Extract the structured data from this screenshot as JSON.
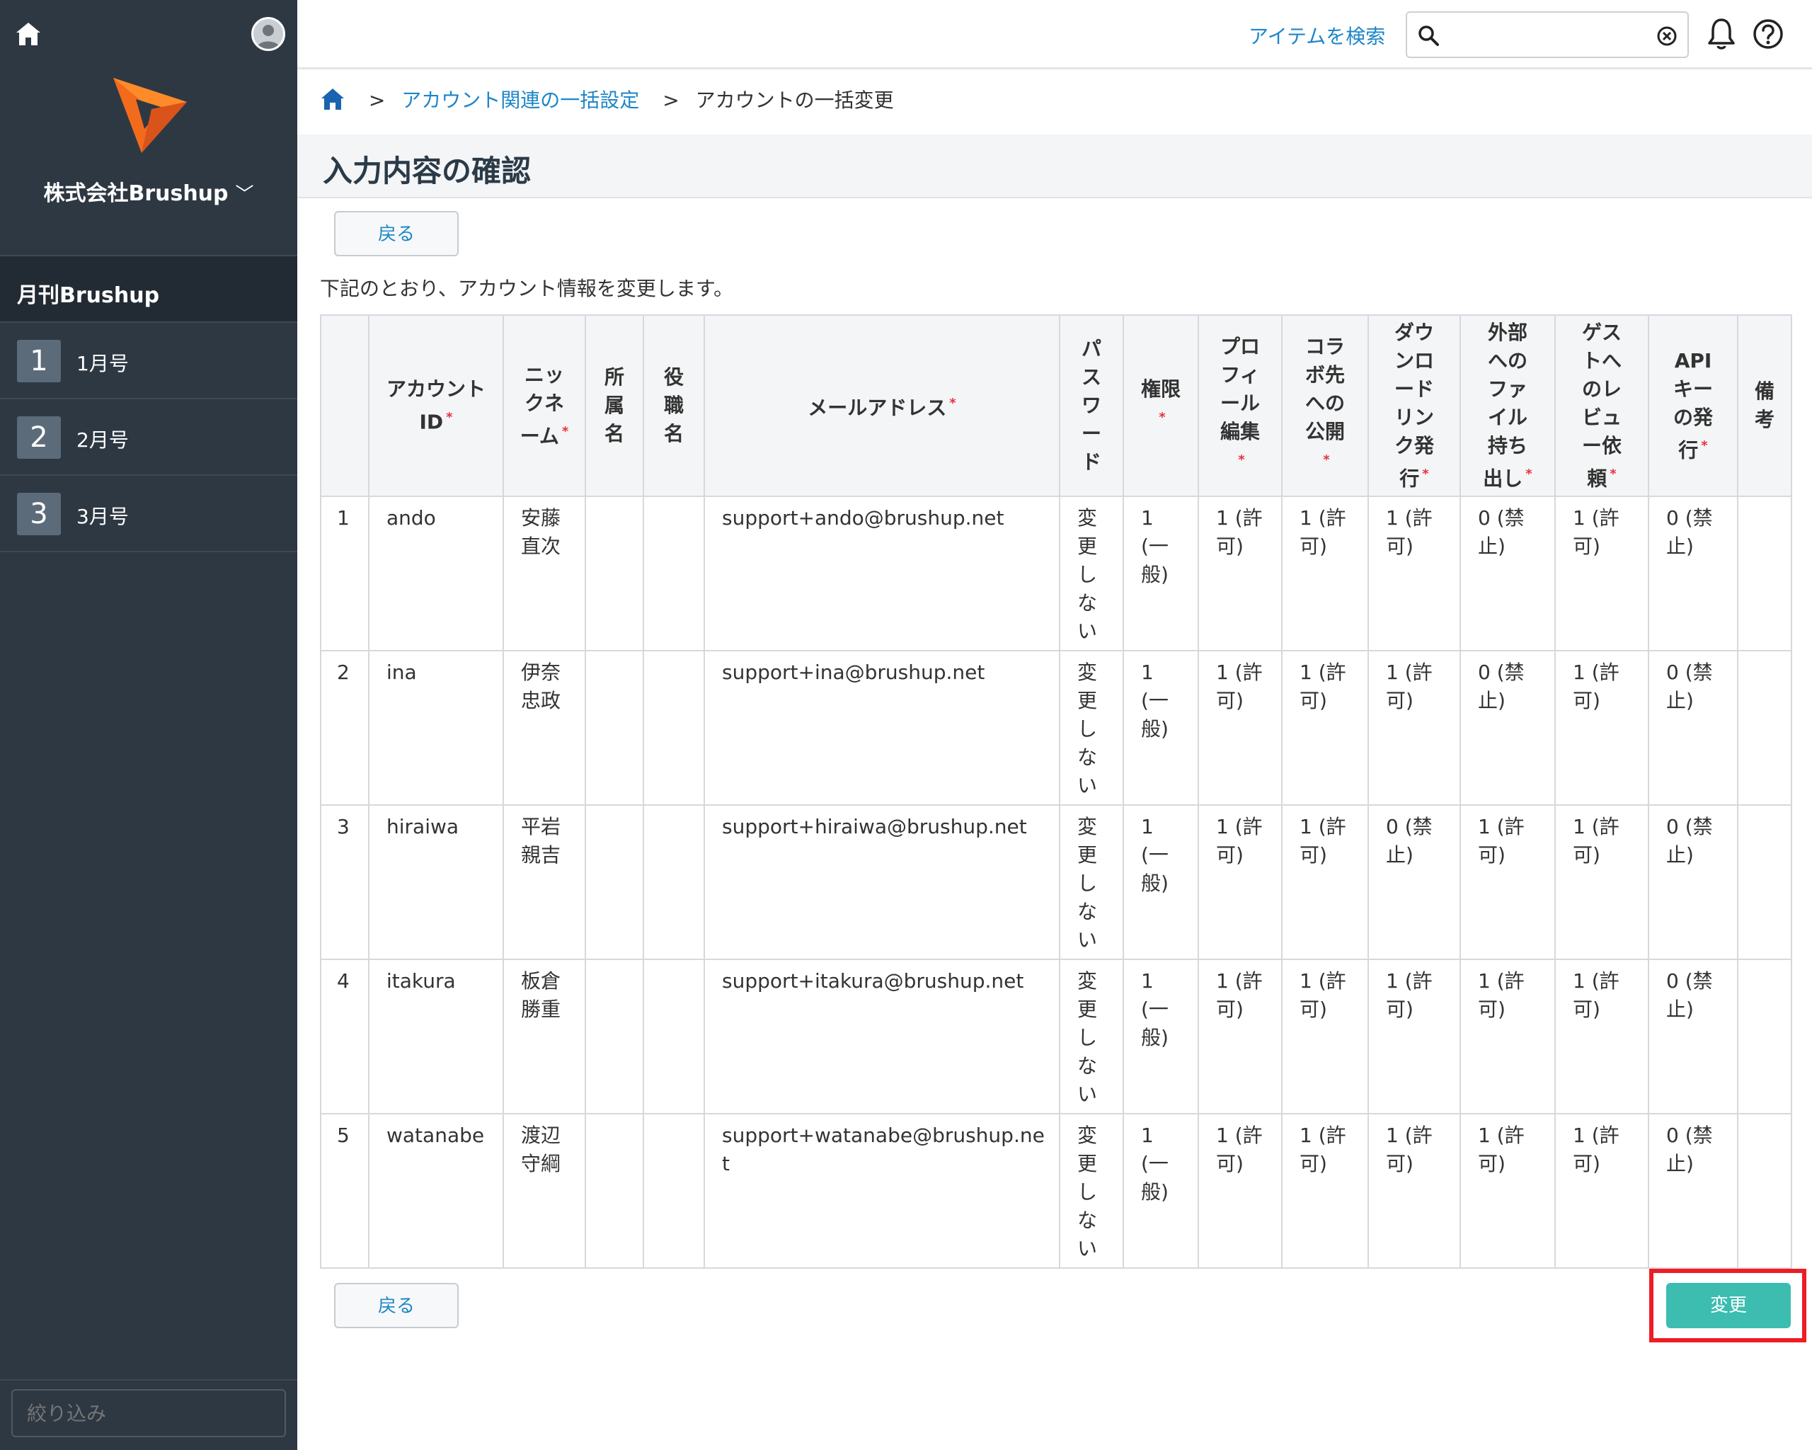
{
  "sidebar": {
    "company": "株式会社Brushup",
    "project": "月刊Brushup",
    "items": [
      {
        "num": "1",
        "label": "1月号"
      },
      {
        "num": "2",
        "label": "2月号"
      },
      {
        "num": "3",
        "label": "3月号"
      }
    ],
    "filter_placeholder": "絞り込み"
  },
  "topbar": {
    "search_link": "アイテムを検索",
    "search_value": ""
  },
  "breadcrumb": {
    "sep": ">",
    "items": [
      "アカウント関連の一括設定",
      "アカウントの一括変更"
    ]
  },
  "page": {
    "title": "入力内容の確認",
    "back_label": "戻る",
    "intro": "下記のとおり、アカウント情報を変更します。",
    "submit_label": "変更"
  },
  "table": {
    "headers": [
      {
        "label": ""
      },
      {
        "label": "アカウントID",
        "required": true
      },
      {
        "label": "ニックネーム",
        "required": true
      },
      {
        "label": "所属名"
      },
      {
        "label": "役職名"
      },
      {
        "label": "メールアドレス",
        "required": true
      },
      {
        "label": "パスワード"
      },
      {
        "label": "権限",
        "required": true
      },
      {
        "label": "プロフィール編集",
        "required": true
      },
      {
        "label": "コラボ先への公開",
        "required": true
      },
      {
        "label": "ダウンロードリンク発行",
        "required": true
      },
      {
        "label": "外部へのファイル持ち出し",
        "required": true
      },
      {
        "label": "ゲストへのレビュー依頼",
        "required": true
      },
      {
        "label": "APIキーの発行",
        "required": true
      },
      {
        "label": "備考"
      }
    ],
    "rows": [
      [
        "1",
        "ando",
        "安藤直次",
        "",
        "",
        "support+ando@brushup.net",
        "変更しない",
        "1 (一般)",
        "1 (許可)",
        "1 (許可)",
        "1 (許可)",
        "0 (禁止)",
        "1 (許可)",
        "0 (禁止)",
        ""
      ],
      [
        "2",
        "ina",
        "伊奈忠政",
        "",
        "",
        "support+ina@brushup.net",
        "変更しない",
        "1 (一般)",
        "1 (許可)",
        "1 (許可)",
        "1 (許可)",
        "0 (禁止)",
        "1 (許可)",
        "0 (禁止)",
        ""
      ],
      [
        "3",
        "hiraiwa",
        "平岩親吉",
        "",
        "",
        "support+hiraiwa@brushup.net",
        "変更しない",
        "1 (一般)",
        "1 (許可)",
        "1 (許可)",
        "0 (禁止)",
        "1 (許可)",
        "1 (許可)",
        "0 (禁止)",
        ""
      ],
      [
        "4",
        "itakura",
        "板倉勝重",
        "",
        "",
        "support+itakura@brushup.net",
        "変更しない",
        "1 (一般)",
        "1 (許可)",
        "1 (許可)",
        "1 (許可)",
        "1 (許可)",
        "1 (許可)",
        "0 (禁止)",
        ""
      ],
      [
        "5",
        "watanabe",
        "渡辺守綱",
        "",
        "",
        "support+watanabe@brushup.net",
        "変更しない",
        "1 (一般)",
        "1 (許可)",
        "1 (許可)",
        "1 (許可)",
        "1 (許可)",
        "1 (許可)",
        "0 (禁止)",
        ""
      ]
    ]
  },
  "colors": {
    "sidebar_bg": "#2e3843",
    "accent_link": "#1e86c8",
    "submit_bg": "#3cbdb0",
    "highlight_frame": "#ee1c25",
    "logo_orange": "#f26b1d"
  }
}
